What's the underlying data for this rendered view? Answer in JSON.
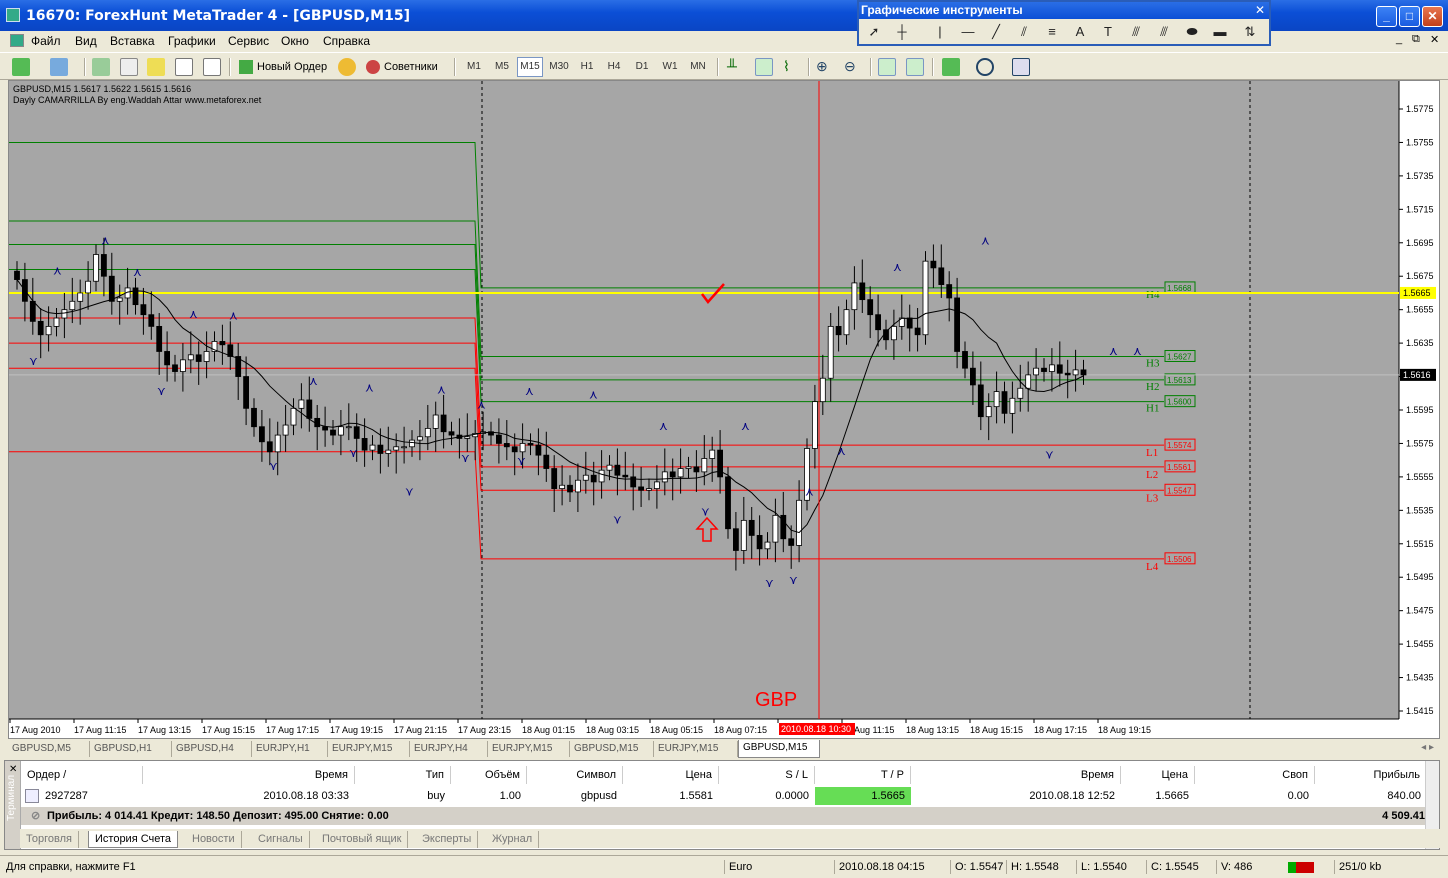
{
  "window": {
    "title": "16670: ForexHunt MetaTrader 4 - [GBPUSD,M15]"
  },
  "menu": [
    "Файл",
    "Вид",
    "Вставка",
    "Графики",
    "Сервис",
    "Окно",
    "Справка"
  ],
  "toolbar": {
    "new_order": "Новый Ордер",
    "advisors": "Советники",
    "timeframes": [
      "M1",
      "M5",
      "M15",
      "M30",
      "H1",
      "H4",
      "D1",
      "W1",
      "MN"
    ],
    "active_tf": "M15"
  },
  "graphic_tools": {
    "title": "Графические инструменты"
  },
  "chart": {
    "info_line1": "GBPUSD,M15  1.5617 1.5622 1.5615 1.5616",
    "info_line2": "Dayly CAMARRILLA By eng.Waddah Attar www.metaforex.net",
    "annotation": "GBP",
    "price_ticks": [
      "1.5775",
      "1.5755",
      "1.5735",
      "1.5715",
      "1.5695",
      "1.5675",
      "1.5655",
      "1.5635",
      "1.5615",
      "1.5595",
      "1.5575",
      "1.5555",
      "1.5535",
      "1.5515",
      "1.5495",
      "1.5475",
      "1.5455",
      "1.5435",
      "1.5415"
    ],
    "time_ticks": [
      "17 Aug 2010",
      "17 Aug 11:15",
      "17 Aug 13:15",
      "17 Aug 15:15",
      "17 Aug 17:15",
      "17 Aug 19:15",
      "17 Aug 21:15",
      "17 Aug 23:15",
      "18 Aug 01:15",
      "18 Aug 03:15",
      "18 Aug 05:15",
      "18 Aug 07:15",
      "",
      "18 Aug 11:15",
      "18 Aug 13:15",
      "18 Aug 15:15",
      "18 Aug 17:15",
      "18 Aug 19:15"
    ],
    "crosshair_time": "2010.08.18 10:30",
    "current_price": "1.5616",
    "yellow_price": "1.5665",
    "levels": [
      {
        "name": "H4",
        "value": "1.5668",
        "color": "#008000"
      },
      {
        "name": "H3",
        "value": "1.5627",
        "color": "#008000"
      },
      {
        "name": "H2",
        "value": "1.5613",
        "color": "#008000"
      },
      {
        "name": "H1",
        "value": "1.5600",
        "color": "#008000"
      },
      {
        "name": "L1",
        "value": "1.5574",
        "color": "#ff0000"
      },
      {
        "name": "L2",
        "value": "1.5561",
        "color": "#ff0000"
      },
      {
        "name": "L3",
        "value": "1.5547",
        "color": "#ff0000"
      },
      {
        "name": "L4",
        "value": "1.5506",
        "color": "#ff0000"
      }
    ]
  },
  "chart_tabs": [
    "GBPUSD,M5",
    "GBPUSD,H1",
    "GBPUSD,H4",
    "EURJPY,H1",
    "EURJPY,M15",
    "EURJPY,H4",
    "EURJPY,M15",
    "GBPUSD,M15",
    "EURJPY,M15",
    "GBPUSD,M15"
  ],
  "active_chart_tab": 9,
  "terminal": {
    "side_label": "Терминал",
    "headers": [
      "Ордер  /",
      "Время",
      "Тип",
      "Объём",
      "Символ",
      "Цена",
      "S / L",
      "T / P",
      "Время",
      "Цена",
      "Своп",
      "Прибыль"
    ],
    "row": [
      "2927287",
      "2010.08.18 03:33",
      "buy",
      "1.00",
      "gbpusd",
      "1.5581",
      "0.0000",
      "1.5665",
      "2010.08.18 12:52",
      "1.5665",
      "0.00",
      "840.00"
    ],
    "summary": "Прибыль: 4 014.41  Кредит: 148.50  Депозит: 495.00  Снятие: 0.00",
    "summary_total": "4 509.41",
    "tabs": [
      "Торговля",
      "История Счета",
      "Новости",
      "Сигналы",
      "Почтовый ящик",
      "Эксперты",
      "Журнал"
    ],
    "active_tab": 1
  },
  "status": {
    "help": "Для справки, нажмите F1",
    "profile": "Euro",
    "time": "2010.08.18 04:15",
    "open": "O: 1.5547",
    "high": "H: 1.5548",
    "low": "L: 1.5540",
    "close": "C: 1.5545",
    "volume": "V: 486",
    "traffic": "251/0 kb"
  }
}
